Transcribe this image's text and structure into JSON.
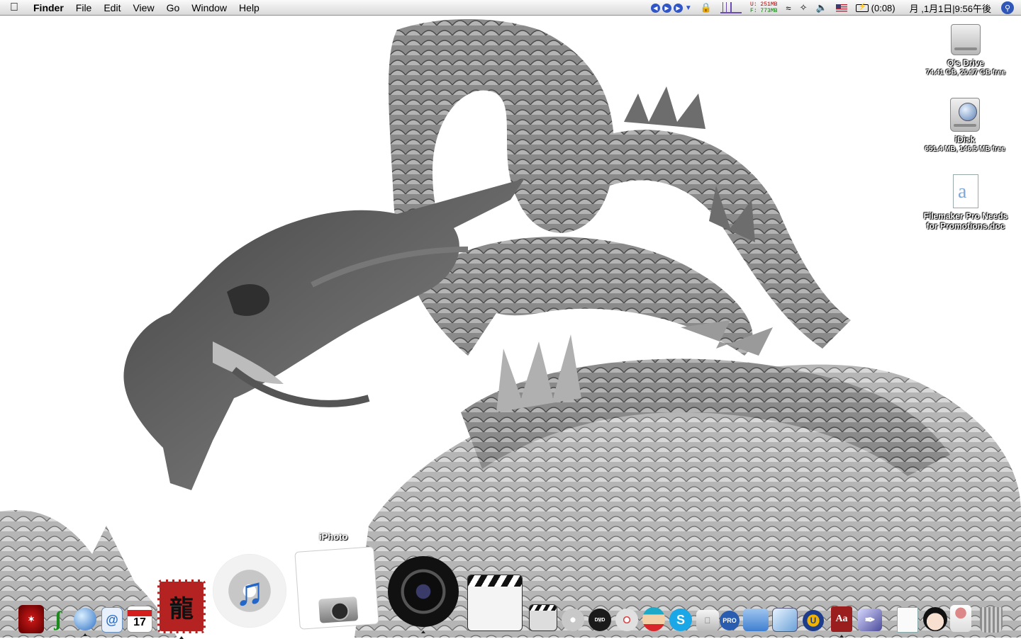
{
  "menubar": {
    "app_name": "Finder",
    "menus": [
      "File",
      "Edit",
      "View",
      "Go",
      "Window",
      "Help"
    ],
    "memory_used": "U: 251MB",
    "memory_free": "F: 773MB",
    "battery_time": "(0:08)",
    "clock": "月 ,1月1日|9:56午後"
  },
  "desktop": {
    "drive": {
      "name": "Q's Drive",
      "info": "74.41 GB, 20.97 GB free"
    },
    "idisk": {
      "name": "iDisk",
      "info": "651.4 MB, 146.5 MB free"
    },
    "document": {
      "name_line1": "Filemaker Pro Needs",
      "name_line2": "for Promotions.doc"
    }
  },
  "dock": {
    "tooltip": "iPhoto",
    "items": [
      "tabasco-icon",
      "fetch-icon",
      "network-globe-icon",
      "mail-at-icon",
      "ical-icon",
      "dragon-stamp-icon",
      "itunes-icon",
      "iphoto-icon",
      "aperture-icon",
      "final-cut-clapper-icon",
      "imovie-clapper-icon",
      "dvd-studio-icon",
      "dvd-player-icon",
      "toast-icon",
      "cartman-icon",
      "skype-icon",
      "apple-hardware-icon",
      "pro-app-icon",
      "blue-folder-icon",
      "preview-icon",
      "textedit-icon",
      "ubiquity-icon",
      "dictionary-icon",
      "quill-icon",
      "document-icon",
      "geisha-icon",
      "dancer-icon",
      "trash-icon"
    ],
    "ical_date": "17",
    "dictionary_text": "Aa"
  },
  "colors": {
    "menubar_top": "#fafafa",
    "menubar_bottom": "#d9d9d9",
    "highlight_blue": "#2f55c8"
  }
}
